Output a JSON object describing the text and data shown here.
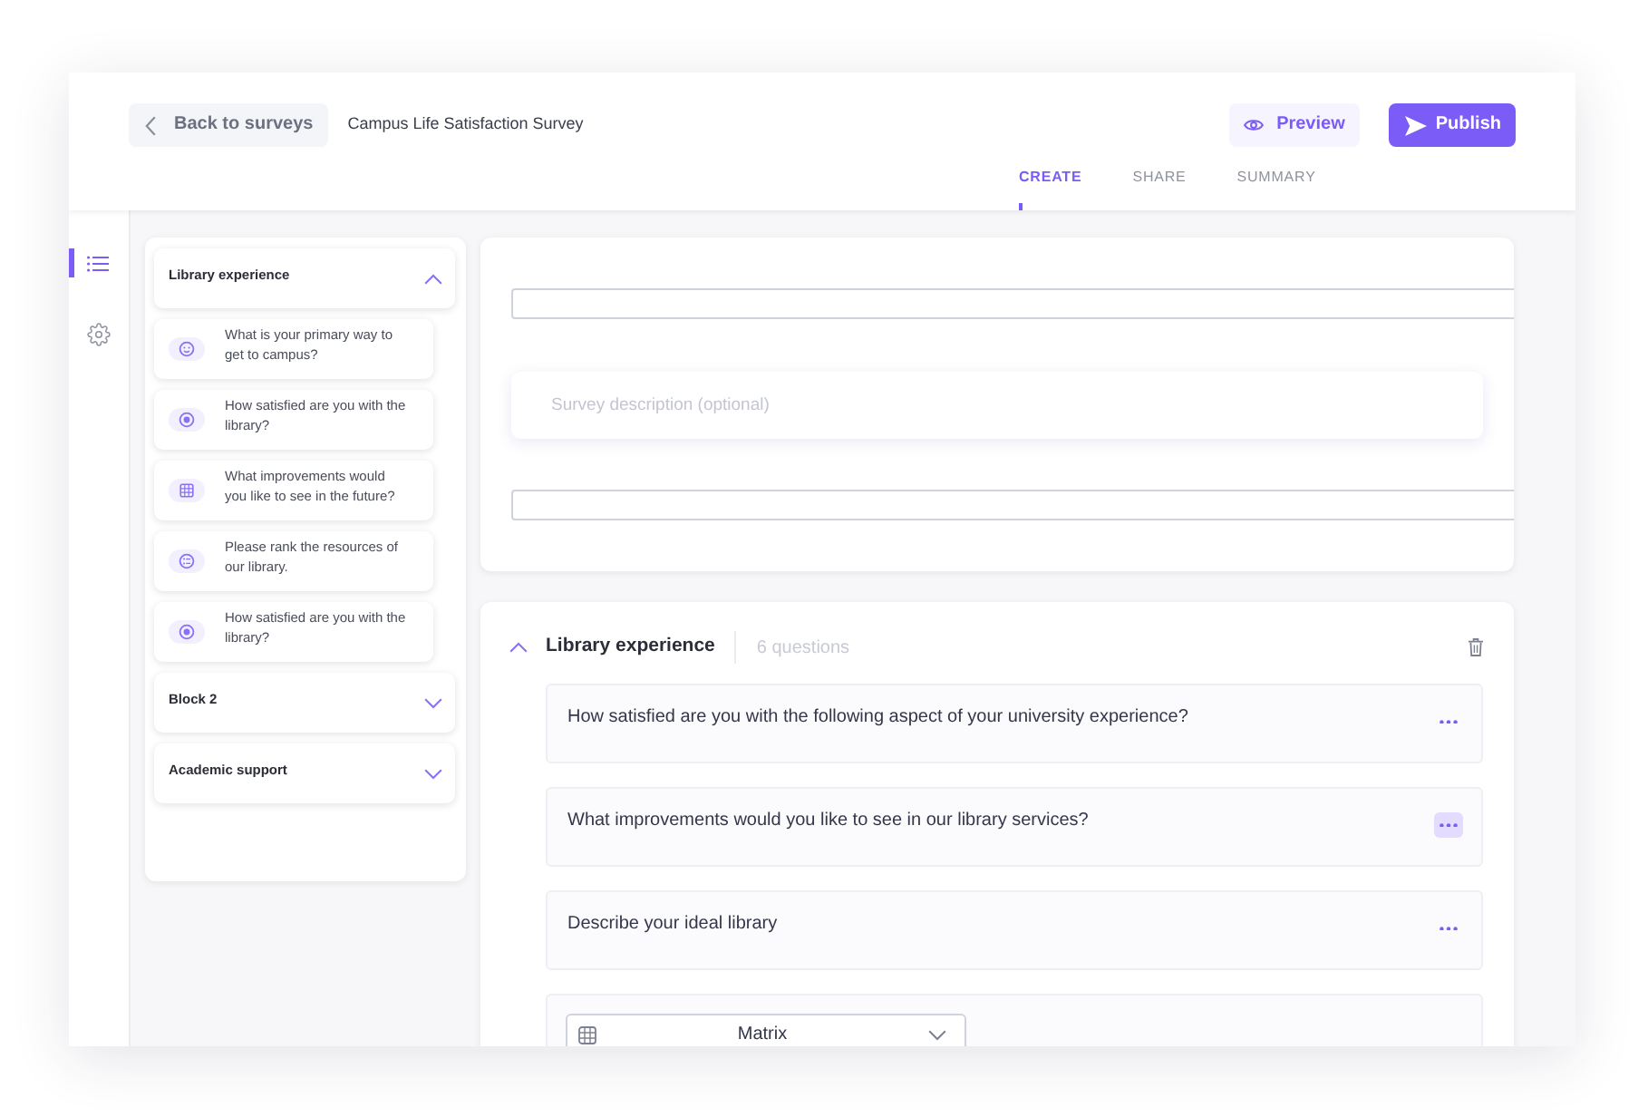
{
  "header": {
    "back_button": "Back to surveys",
    "survey_title": "Campus Life Satisfaction Survey",
    "preview_button": "Preview",
    "publish_button": "Publish"
  },
  "tabs": [
    {
      "label": "CREATE",
      "selected": true
    },
    {
      "label": "SHARE",
      "selected": false
    },
    {
      "label": "SUMMARY",
      "selected": false
    }
  ],
  "side_rail": [
    {
      "kind": "outline",
      "selected": true
    },
    {
      "kind": "settings",
      "selected": false
    }
  ],
  "block_outline": [
    {
      "title": "Library experience",
      "expanded": true,
      "questions": [
        {
          "kind": "emoji",
          "text": "What is your primary way to get to campus?"
        },
        {
          "kind": "choice",
          "text": "How satisfied are you with the library?"
        },
        {
          "kind": "matrix",
          "text": "What improvements would you like to see in the future?"
        },
        {
          "kind": "ranking",
          "text": "Please rank the resources of our library."
        },
        {
          "kind": "choice",
          "text": "How satisfied are you with the library?"
        }
      ]
    },
    {
      "title": "Block 2",
      "expanded": false
    },
    {
      "title": "Academic support",
      "expanded": false
    }
  ],
  "survey_form": {
    "description": {
      "placeholder": "Survey description (optional)"
    }
  },
  "block": {
    "title": "Library experience",
    "expanded": true,
    "question_count": "6 questions",
    "items": [
      {
        "kind": "question",
        "text": "How satisfied are you with the following aspect of your university experience?",
        "menu_hovered": false
      },
      {
        "kind": "question",
        "text": "What improvements would you like to see in our library services?",
        "menu_hovered": true
      },
      {
        "kind": "question",
        "text": "Describe your ideal library",
        "menu_hovered": false
      },
      {
        "kind": "editor",
        "question_type": "Matrix"
      }
    ]
  }
}
